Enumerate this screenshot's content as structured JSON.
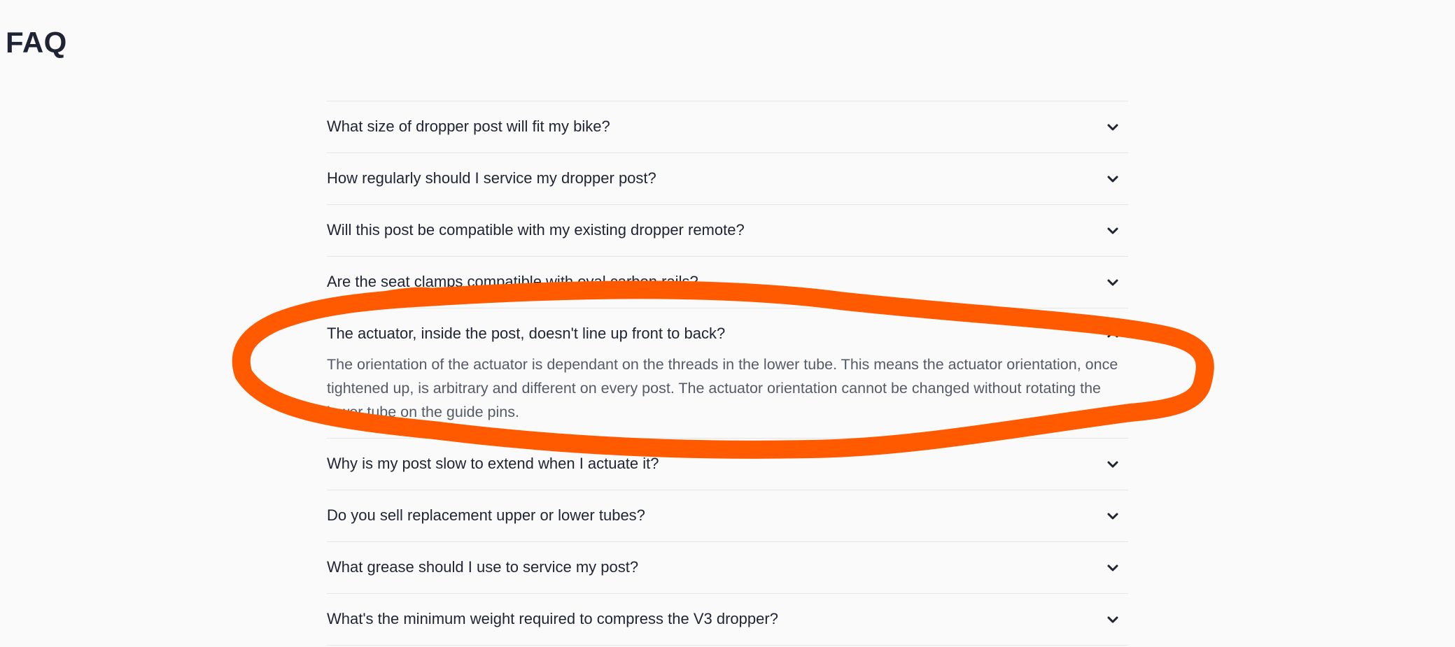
{
  "page": {
    "title": "FAQ"
  },
  "faq": {
    "items": [
      {
        "question": "What size of dropper post will fit my bike?",
        "expanded": false,
        "icon": "chevron-down-icon"
      },
      {
        "question": "How regularly should I service my dropper post?",
        "expanded": false,
        "icon": "chevron-down-icon"
      },
      {
        "question": "Will this post be compatible with my existing dropper remote?",
        "expanded": false,
        "icon": "chevron-down-icon"
      },
      {
        "question": "Are the seat clamps compatible with oval carbon rails?",
        "expanded": false,
        "icon": "chevron-down-icon"
      },
      {
        "question": "The actuator, inside the post, doesn't line up front to back?",
        "expanded": true,
        "icon": "chevron-up-icon",
        "answer": "The orientation of the actuator is dependant on the threads in the lower tube. This means the actuator orientation, once tightened up, is arbitrary and different on every post. The actuator orientation cannot be changed without rotating the lower tube on the guide pins."
      },
      {
        "question": "Why is my post slow to extend when I actuate it?",
        "expanded": false,
        "icon": "chevron-down-icon"
      },
      {
        "question": "Do you sell replacement upper or lower tubes?",
        "expanded": false,
        "icon": "chevron-down-icon"
      },
      {
        "question": "What grease should I use to service my post?",
        "expanded": false,
        "icon": "chevron-down-icon"
      },
      {
        "question": "What's the minimum weight required to compress the V3 dropper?",
        "expanded": false,
        "icon": "chevron-down-icon"
      }
    ]
  },
  "annotation": {
    "shape": "hand-drawn-ellipse",
    "color": "#ff5a00",
    "target_item": 4
  },
  "colors": {
    "background": "#fafafa",
    "text": "#1f2433",
    "answer_text": "#555b66",
    "divider": "#e6e6e6"
  }
}
